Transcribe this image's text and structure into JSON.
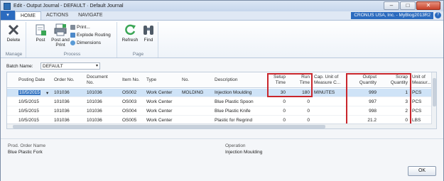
{
  "window": {
    "title": "Edit - Output Journal - DEFAULT · Default Journal",
    "minimize": "–",
    "maximize": "□",
    "close": "✕"
  },
  "ribbon": {
    "app_menu_symbol": "▾",
    "tabs": [
      "HOME",
      "ACTIONS",
      "NAVIGATE"
    ],
    "active_tab": "HOME",
    "company": "CRONUS USA, Inc. - MyBlog2013R2",
    "help_symbol": "?",
    "groups": {
      "manage": {
        "label": "Manage",
        "delete": {
          "label": "Delete",
          "icon": "delete-x-icon"
        }
      },
      "process": {
        "label": "Process",
        "post": {
          "label": "Post",
          "icon": "post-icon"
        },
        "post_and_print": {
          "label1": "Post and",
          "label2": "Print",
          "icon": "post-print-icon"
        },
        "print": {
          "label": "Print...",
          "icon": "printer-icon"
        },
        "explode_routing": {
          "label": "Explode Routing",
          "icon": "explode-routing-icon"
        },
        "dimensions": {
          "label": "Dimensions",
          "icon": "dimensions-icon"
        }
      },
      "page": {
        "label": "Page",
        "refresh": {
          "label": "Refresh",
          "icon": "refresh-icon"
        },
        "find": {
          "label": "Find",
          "icon": "binoculars-icon"
        }
      }
    }
  },
  "batch": {
    "label": "Batch Name:",
    "value": "DEFAULT",
    "arrow": "▾"
  },
  "grid": {
    "columns": {
      "posting_date": "Posting Date",
      "order_no": "Order No.",
      "document_no_1": "Document",
      "document_no_2": "No.",
      "item_no": "Item No.",
      "type": "Type",
      "no": "No.",
      "description": "Description",
      "setup_time_1": "Setup",
      "setup_time_2": "Time",
      "run_time_1": "Run",
      "run_time_2": "Time",
      "cap_unit_1": "Cap. Unit of",
      "cap_unit_2": "Measure C...",
      "output_qty_1": "Output",
      "output_qty_2": "Quantity",
      "scrap_qty_1": "Scrap",
      "scrap_qty_2": "Quantity",
      "unit_of_1": "Unit of",
      "unit_of_2": "Measur..."
    },
    "rows": [
      {
        "posting_date": "10/5/2015",
        "order_no": "101036",
        "document_no": "101036",
        "item_no": "OS002",
        "type": "Work Center",
        "no": "MOLDING",
        "description": "Injection Moulding",
        "setup_time": "30",
        "run_time": "180",
        "cap_unit": "MINUTES",
        "output_qty": "999",
        "scrap_qty": "1",
        "unit": "PCS",
        "row_arrow": "▾"
      },
      {
        "posting_date": "10/5/2015",
        "order_no": "101036",
        "document_no": "101036",
        "item_no": "OS003",
        "type": "Work Center",
        "no": "",
        "description": "Blue Plastic Spoon",
        "setup_time": "0",
        "run_time": "0",
        "cap_unit": "",
        "output_qty": "997",
        "scrap_qty": "3",
        "unit": "PCS"
      },
      {
        "posting_date": "10/5/2015",
        "order_no": "101036",
        "document_no": "101036",
        "item_no": "OS004",
        "type": "Work Center",
        "no": "",
        "description": "Blue Plastic Knife",
        "setup_time": "0",
        "run_time": "0",
        "cap_unit": "",
        "output_qty": "998",
        "scrap_qty": "2",
        "unit": "PCS"
      },
      {
        "posting_date": "10/5/2015",
        "order_no": "101036",
        "document_no": "101036",
        "item_no": "OS005",
        "type": "Work Center",
        "no": "",
        "description": "Plastic for Regrind",
        "setup_time": "0",
        "run_time": "0",
        "cap_unit": "",
        "output_qty": "21.2",
        "scrap_qty": "0",
        "unit": "LBS"
      }
    ]
  },
  "factbox": {
    "prod_order_name_label": "Prod. Order Name",
    "prod_order_name_value": "Blue Plastic Fork",
    "operation_label": "Operation",
    "operation_value": "Injection Moulding"
  },
  "ok_button": "OK",
  "colors": {
    "accent": "#2b6bbf",
    "highlight_box": "#c9262c",
    "selected_row": "#cfe3f7"
  }
}
